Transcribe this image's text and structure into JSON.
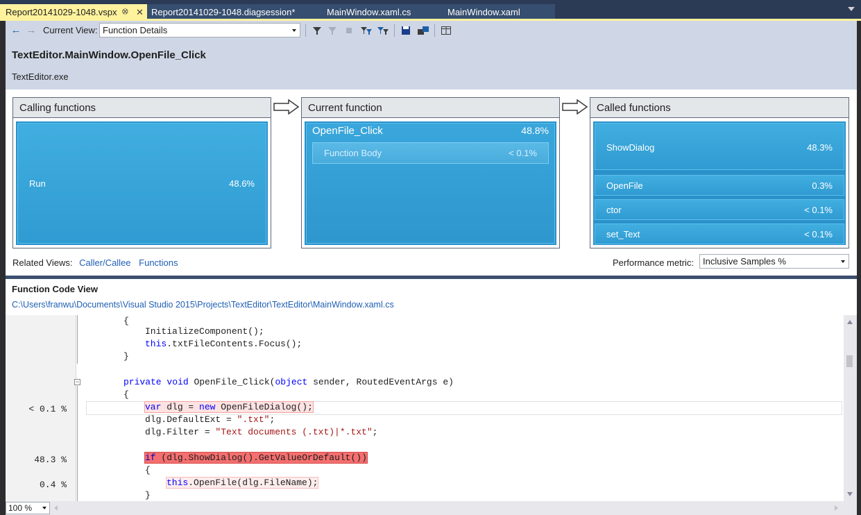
{
  "tabs": [
    {
      "label": "Report20141029-1048.vspx",
      "active": true
    },
    {
      "label": "Report20141029-1048.diagsession*",
      "active": false
    },
    {
      "label": "MainWindow.xaml.cs",
      "active": false
    },
    {
      "label": "MainWindow.xaml",
      "active": false
    }
  ],
  "toolbar": {
    "current_view_label": "Current View:",
    "current_view_value": "Function Details",
    "icons": [
      "back-arrow-icon",
      "forward-arrow-icon",
      "filter-icon",
      "clear-filter-icon",
      "stop-icon",
      "filter-tool-icon",
      "filter-tool-2-icon",
      "save-icon",
      "export-icon",
      "layout-icon"
    ]
  },
  "header": {
    "function_name": "TextEditor.MainWindow.OpenFile_Click",
    "module": "TextEditor.exe"
  },
  "calling": {
    "title": "Calling functions",
    "items": [
      {
        "name": "Run",
        "value": "48.6%"
      }
    ]
  },
  "current": {
    "title": "Current function",
    "name": "OpenFile_Click",
    "value": "48.8%",
    "body": {
      "name": "Function Body",
      "value": "< 0.1%"
    }
  },
  "called": {
    "title": "Called functions",
    "items": [
      {
        "name": "ShowDialog",
        "value": "48.3%"
      },
      {
        "name": "OpenFile",
        "value": "0.3%"
      },
      {
        "name": "ctor",
        "value": "< 0.1%"
      },
      {
        "name": "set_Text",
        "value": "< 0.1%"
      }
    ]
  },
  "related": {
    "label": "Related Views:",
    "links": [
      "Caller/Callee",
      "Functions"
    ]
  },
  "metric": {
    "label": "Performance metric:",
    "value": "Inclusive Samples %"
  },
  "code_view": {
    "title": "Function Code View",
    "path": "C:\\Users\\franwu\\Documents\\Visual Studio 2015\\Projects\\TextEditor\\TextEditor\\MainWindow.xaml.cs",
    "zoom": "100 %",
    "percents": [
      "< 0.1 %",
      "48.3 %",
      "0.4 %"
    ],
    "lines": {
      "brace_open_1": "{",
      "init": "InitializeComponent();",
      "focus_kw": "this",
      "focus_rest": ".txtFileContents.Focus();",
      "brace_close_1": "}",
      "sig_kw1": "private",
      "sig_kw2": "void",
      "sig_name": "OpenFile_Click(",
      "sig_kw3": "object",
      "sig_rest": "sender, RoutedEventArgs e)",
      "brace_open_2": "{",
      "var_kw": "var",
      "var_mid": "dlg = ",
      "var_kw2": "new",
      "var_rest": "OpenFileDialog();",
      "ext_a": "dlg.DefaultExt = ",
      "ext_str": "\".txt\"",
      "ext_b": ";",
      "filter_a": "dlg.Filter = ",
      "filter_str": "\"Text documents (.txt)|*.txt\"",
      "filter_b": ";",
      "if_kw": "if",
      "if_rest": "(dlg.ShowDialog().GetValueOrDefault())",
      "brace_open_3": "{",
      "open_kw": "this",
      "open_rest": ".OpenFile(dlg.FileName);",
      "brace_close_3": "}"
    }
  }
}
